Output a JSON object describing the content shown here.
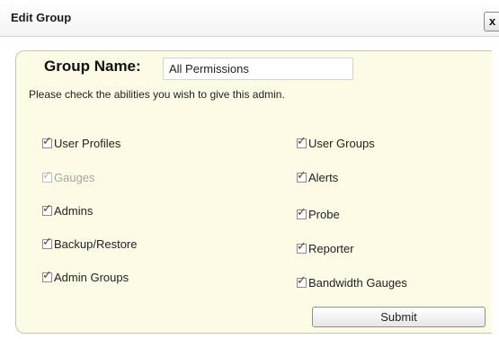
{
  "dialog": {
    "title": "Edit Group",
    "close_label": "x"
  },
  "form": {
    "group_name_label": "Group Name:",
    "group_name_value": "All Permissions",
    "instructions": "Please check the abilities you wish to give this admin.",
    "submit_label": "Submit",
    "check_glyph": "✓"
  },
  "permissions": [
    {
      "label": "User Profiles",
      "checked": true,
      "disabled": false
    },
    {
      "label": "Gauges",
      "checked": true,
      "disabled": true
    },
    {
      "label": "Admins",
      "checked": true,
      "disabled": false
    },
    {
      "label": "Backup/Restore",
      "checked": true,
      "disabled": false
    },
    {
      "label": "Admin Groups",
      "checked": true,
      "disabled": false
    },
    {
      "label": "User Groups",
      "checked": true,
      "disabled": false
    },
    {
      "label": "Alerts",
      "checked": true,
      "disabled": false
    },
    {
      "label": "Probe",
      "checked": true,
      "disabled": false
    },
    {
      "label": "Reporter",
      "checked": true,
      "disabled": false
    },
    {
      "label": "Bandwidth Gauges",
      "checked": true,
      "disabled": false
    }
  ],
  "colors": {
    "panel_background": "#fdfbe5",
    "checkmark": "#8a2e1e",
    "disabled_text": "#a6a6a6"
  }
}
